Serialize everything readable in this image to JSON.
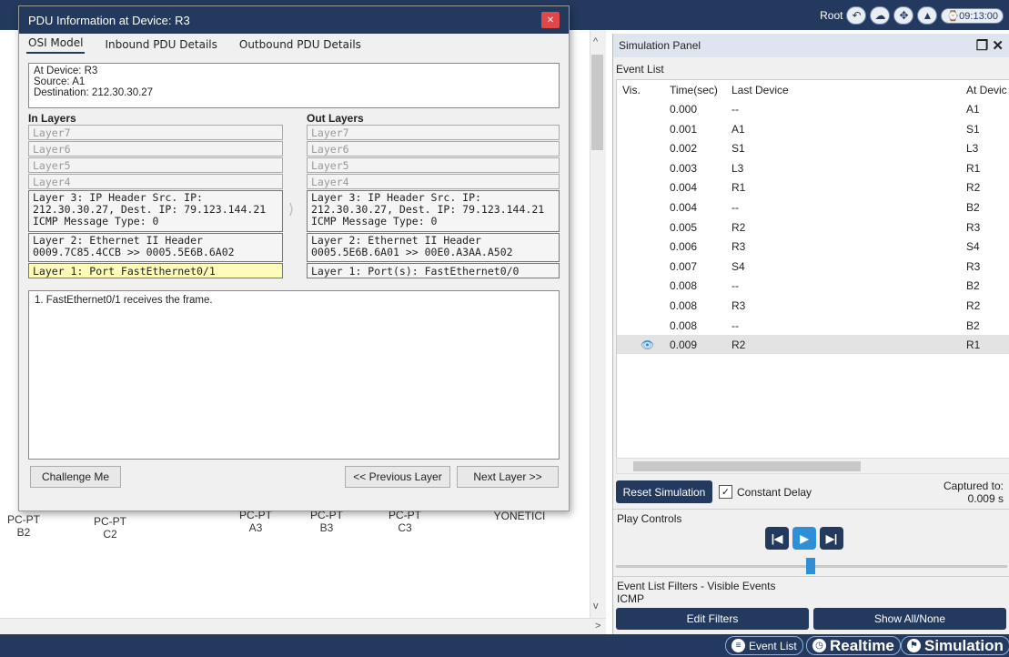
{
  "topbar": {
    "user": "Root",
    "time": "09:13:00"
  },
  "canvas_labels": [
    {
      "text": "PC-PT\nB2"
    },
    {
      "text": "PC-PT\nC2"
    },
    {
      "text": "PC-PT\nA3"
    },
    {
      "text": "PC-PT\nB3"
    },
    {
      "text": "PC-PT\nC3"
    },
    {
      "text": "YÖNETİCİ"
    }
  ],
  "dialog": {
    "title": "PDU Information at Device: R3",
    "tabs": [
      "OSI Model",
      "Inbound PDU Details",
      "Outbound PDU Details"
    ],
    "device_line": "At Device: R3",
    "source_line": "Source: A1",
    "destination_line": "Destination: 212.30.30.27",
    "in_layers_title": "In Layers",
    "out_layers_title": "Out Layers",
    "in_layers": [
      "Layer7",
      "Layer6",
      "Layer5",
      "Layer4",
      "Layer 3: IP Header Src. IP: 212.30.30.27, Dest. IP: 79.123.144.21 ICMP Message Type: 0",
      "Layer 2: Ethernet II Header 0009.7C85.4CCB >> 0005.5E6B.6A02",
      "Layer 1: Port FastEthernet0/1"
    ],
    "out_layers": [
      "Layer7",
      "Layer6",
      "Layer5",
      "Layer4",
      "Layer 3: IP Header Src. IP: 212.30.30.27, Dest. IP: 79.123.144.21 ICMP Message Type: 0",
      "Layer 2: Ethernet II Header 0005.5E6B.6A01 >> 00E0.A3AA.A502",
      "Layer 1: Port(s): FastEthernet0/0"
    ],
    "description": "1. FastEthernet0/1 receives the frame.",
    "challenge_label": "Challenge Me",
    "prev_label": "<< Previous Layer",
    "next_label": "Next Layer >>"
  },
  "sim": {
    "title": "Simulation Panel",
    "event_list_label": "Event List",
    "columns": [
      "Vis.",
      "Time(sec)",
      "Last Device",
      "At Devic"
    ],
    "events": [
      {
        "time": "0.000",
        "last": "--",
        "at": "A1"
      },
      {
        "time": "0.001",
        "last": "A1",
        "at": "S1"
      },
      {
        "time": "0.002",
        "last": "S1",
        "at": "L3"
      },
      {
        "time": "0.003",
        "last": "L3",
        "at": "R1"
      },
      {
        "time": "0.004",
        "last": "R1",
        "at": "R2"
      },
      {
        "time": "0.004",
        "last": "--",
        "at": "B2"
      },
      {
        "time": "0.005",
        "last": "R2",
        "at": "R3"
      },
      {
        "time": "0.006",
        "last": "R3",
        "at": "S4"
      },
      {
        "time": "0.007",
        "last": "S4",
        "at": "R3"
      },
      {
        "time": "0.008",
        "last": "--",
        "at": "B2"
      },
      {
        "time": "0.008",
        "last": "R3",
        "at": "R2"
      },
      {
        "time": "0.008",
        "last": "--",
        "at": "B2"
      },
      {
        "time": "0.009",
        "last": "R2",
        "at": "R1"
      }
    ],
    "reset_label": "Reset Simulation",
    "constant_delay_label": "Constant Delay",
    "captured_label": "Captured to:",
    "captured_value": "0.009 s",
    "play_controls_label": "Play Controls",
    "filters_label": "Event List Filters - Visible Events",
    "filters_value": "ICMP",
    "edit_filters_label": "Edit Filters",
    "show_all_label": "Show All/None"
  },
  "bottombar": {
    "event_list": "Event List",
    "realtime": "Realtime",
    "simulation": "Simulation"
  },
  "colors": {
    "navy": "#233a5e",
    "blue": "#2f8fd6",
    "highlight": "#fffbb8"
  }
}
